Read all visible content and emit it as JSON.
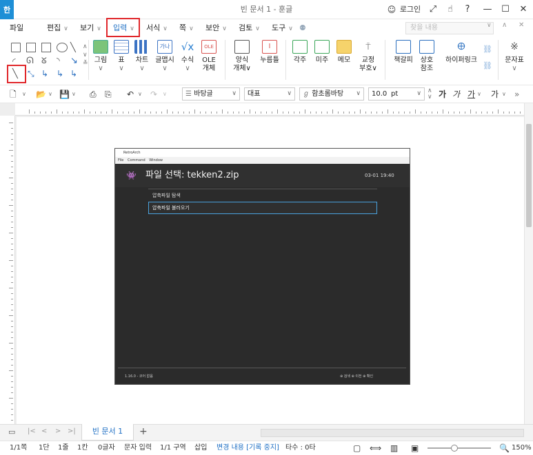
{
  "window": {
    "app_badge": "한",
    "title": "빈 문서 1 - 훈글",
    "login": "로그인",
    "buttons": [
      "⤢",
      "☝",
      "?",
      "—",
      "☐",
      "✕"
    ]
  },
  "menus": [
    {
      "label": "파일",
      "chev": false
    },
    {
      "label": "편집",
      "chev": true
    },
    {
      "label": "보기",
      "chev": true
    },
    {
      "label": "입력",
      "chev": true,
      "active": true
    },
    {
      "label": "서식",
      "chev": true
    },
    {
      "label": "쪽",
      "chev": true
    },
    {
      "label": "보안",
      "chev": true
    },
    {
      "label": "검토",
      "chev": true
    },
    {
      "label": "도구",
      "chev": true
    }
  ],
  "search_placeholder": "찾을 내용",
  "ribbon": {
    "buttons": [
      {
        "label": "그림",
        "sub": "∨",
        "color": "#4caf50"
      },
      {
        "label": "표",
        "sub": "∨",
        "color": "#3b73c4"
      },
      {
        "label": "차트",
        "sub": "∨",
        "color": "#3b73c4"
      },
      {
        "label": "글맵시",
        "sub": "∨",
        "color": "#3b73c4"
      },
      {
        "label": "수식",
        "sub": "∨",
        "color": "#2a7fd1"
      },
      {
        "label": "OLE",
        "sub": "개체",
        "color": "#d9534f"
      },
      {
        "label": "양식",
        "sub": "개체∨",
        "color": "#5a5a5a"
      },
      {
        "label": "누름틀",
        "sub": "",
        "color": "#d9534f"
      },
      {
        "label": "각주",
        "sub": "",
        "color": "#3aa658"
      },
      {
        "label": "미주",
        "sub": "",
        "color": "#3aa658"
      },
      {
        "label": "메모",
        "sub": "",
        "color": "#f0c040"
      },
      {
        "label": "교정",
        "sub": "부호∨",
        "color": "#555555"
      },
      {
        "label": "책갈피",
        "sub": "",
        "color": "#2a6fbf"
      },
      {
        "label": "상호",
        "sub": "참조",
        "color": "#2a6fbf"
      },
      {
        "label": "하이퍼링크",
        "sub": "",
        "color": "#2a6fbf"
      },
      {
        "label": "문자표",
        "sub": "∨",
        "color": "#555555"
      }
    ]
  },
  "format": {
    "style_name": "바탕글",
    "outline": "대표",
    "font": "함초롬바탕",
    "size": "10.0",
    "unit": "pt",
    "glyphs": [
      "가",
      "가",
      "가",
      "가"
    ]
  },
  "embedded": {
    "app_title": "RetroArch",
    "menu": [
      "File",
      "Command",
      "Window"
    ],
    "heading": "파일 선택: tekken2.zip",
    "clock": "03-01 19:40",
    "item_browse": "압축파일 탐색",
    "item_load": "압축파일 불러오기",
    "version": "1.16.0 - 코어 없음",
    "actions": "⊕ 검색   ⊕ 이전   ⊕ 확인"
  },
  "tabs": {
    "doc_name": "빈 문서 1",
    "add": "+"
  },
  "status": {
    "page": "1/1쪽",
    "column": "1단",
    "line": "1줄",
    "col": "1칸",
    "chars": "0글자",
    "mode": "문자 입력",
    "section": "1/1 구역",
    "insert": "삽입",
    "track": "변경 내용 [기록 중지]",
    "keystrokes": "타수 : 0타",
    "zoom": "150%"
  }
}
